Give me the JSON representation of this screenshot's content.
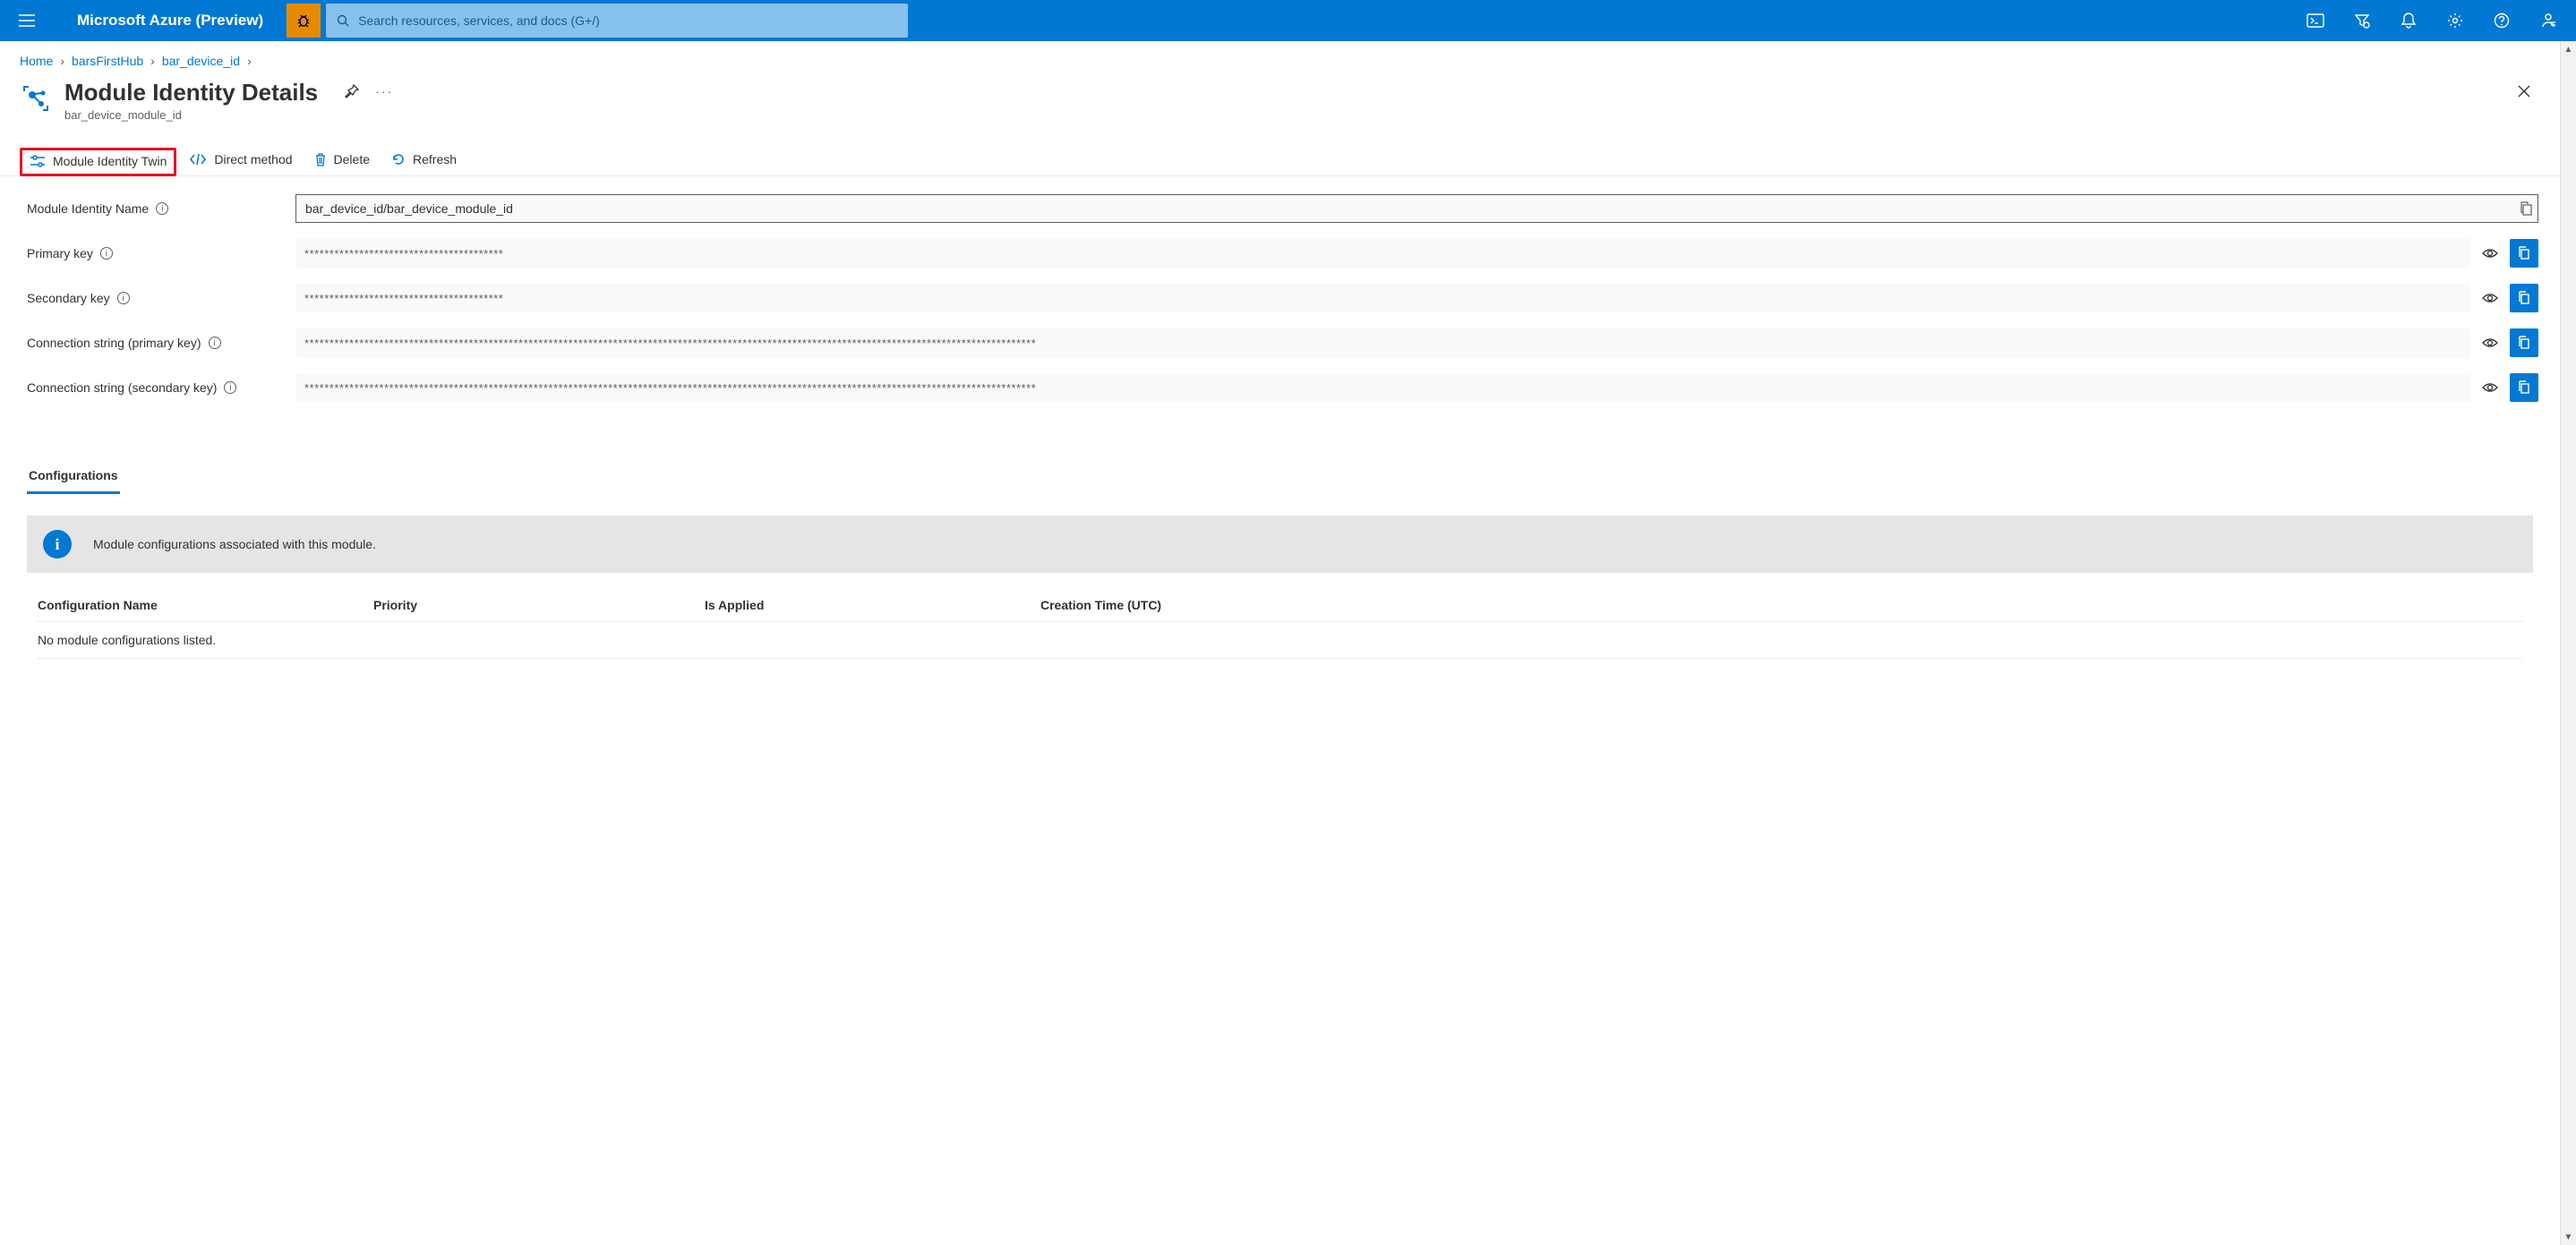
{
  "header": {
    "brand": "Microsoft Azure (Preview)",
    "search_placeholder": "Search resources, services, and docs (G+/)"
  },
  "breadcrumbs": {
    "items": [
      "Home",
      "barsFirstHub",
      "bar_device_id"
    ]
  },
  "page": {
    "title": "Module Identity Details",
    "subtitle": "bar_device_module_id"
  },
  "toolbar": {
    "twin": "Module Identity Twin",
    "direct": "Direct method",
    "delete": "Delete",
    "refresh": "Refresh"
  },
  "fields": {
    "name_label": "Module Identity Name",
    "name_value": "bar_device_id/bar_device_module_id",
    "primary_label": "Primary key",
    "primary_value": "****************************************",
    "secondary_label": "Secondary key",
    "secondary_value": "****************************************",
    "conn_primary_label": "Connection string (primary key)",
    "conn_primary_value": "***************************************************************************************************************************************************",
    "conn_secondary_label": "Connection string (secondary key)",
    "conn_secondary_value": "***************************************************************************************************************************************************"
  },
  "section": {
    "tab": "Configurations",
    "banner": "Module configurations associated with this module.",
    "col1": "Configuration Name",
    "col2": "Priority",
    "col3": "Is Applied",
    "col4": "Creation Time (UTC)",
    "empty": "No module configurations listed."
  }
}
